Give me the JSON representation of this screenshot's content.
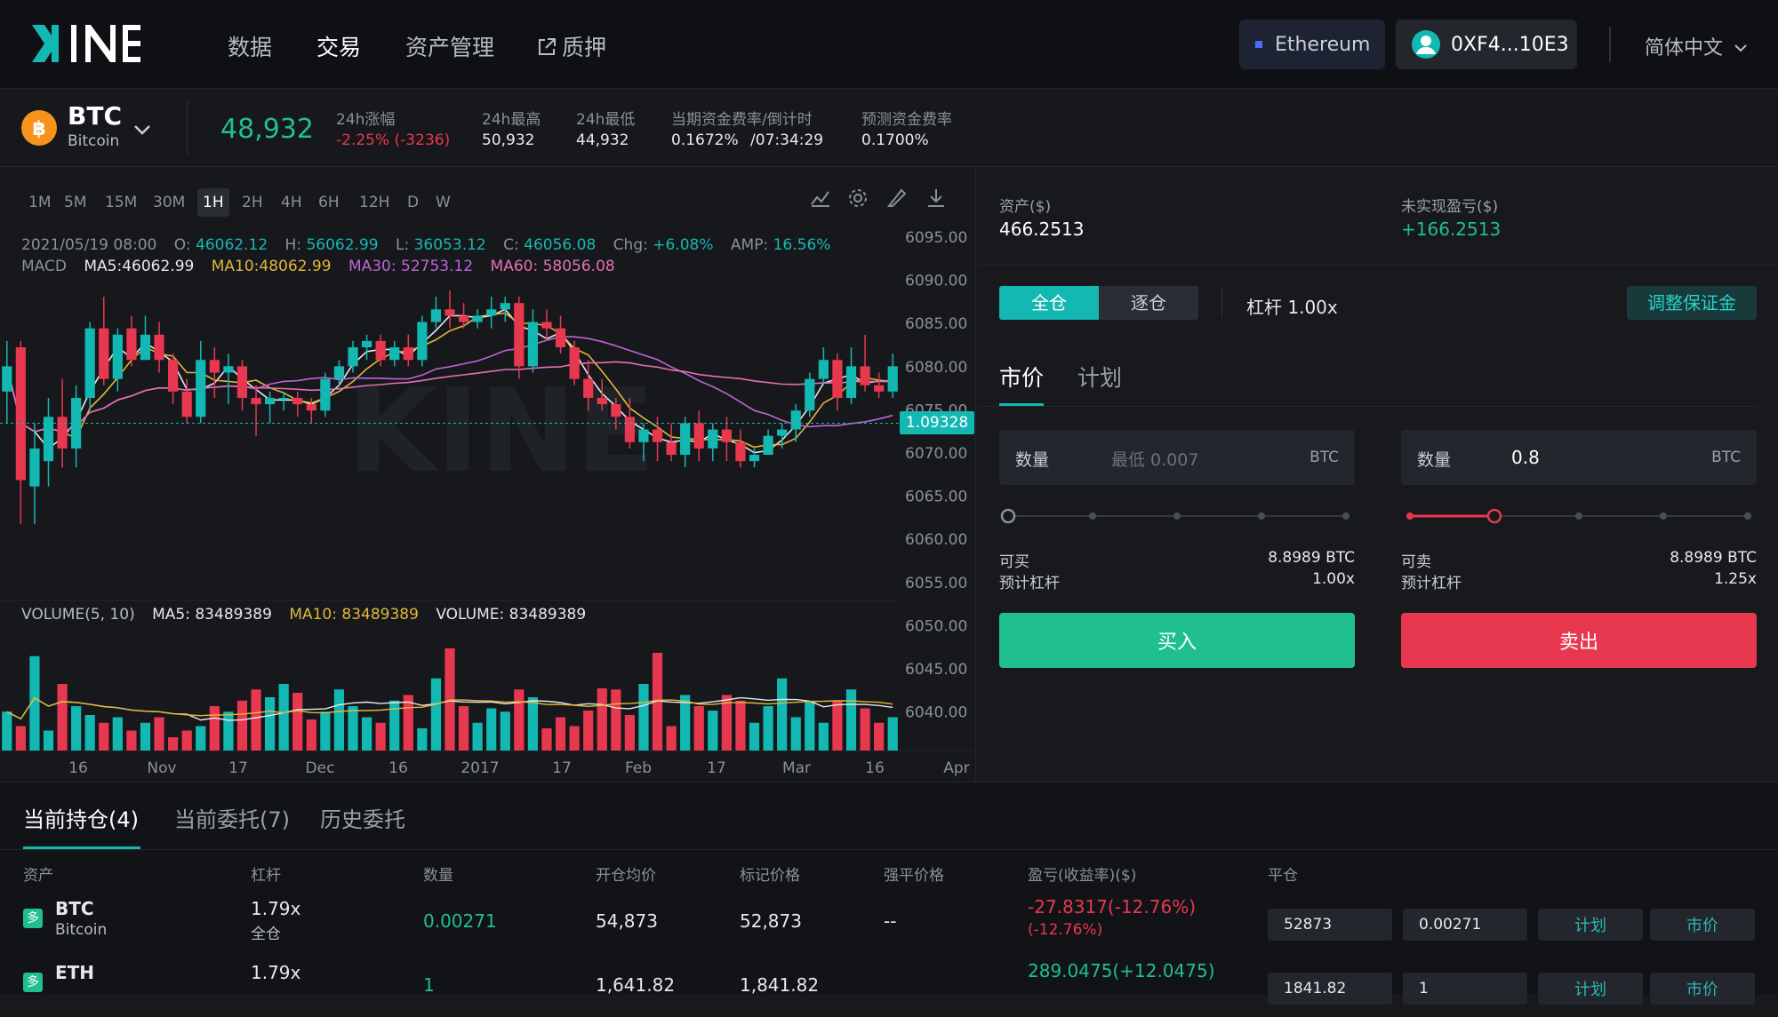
{
  "colors": {
    "accent": "#14b8b3",
    "up": "#1fbf8f",
    "down": "#e8384f",
    "bg": "#16181c"
  },
  "header": {
    "logo_text": "KINE",
    "nav": [
      {
        "label": "数据"
      },
      {
        "label": "交易"
      },
      {
        "label": "资产管理"
      },
      {
        "label": "质押",
        "icon": "external-link-icon"
      }
    ],
    "network": "Ethereum",
    "wallet": "0XF4...10E3",
    "language": "简体中文"
  },
  "ticker": {
    "symbol": "BTC",
    "name": "Bitcoin",
    "price": "48,932",
    "change_label": "24h涨幅",
    "change_value": "-2.25% (-3236)",
    "high_label": "24h最高",
    "high_value": "50,932",
    "low_label": "24h最低",
    "low_value": "44,932",
    "funding_label": "当期资金费率/倒计时",
    "funding_value": "0.1672%",
    "funding_countdown": "/07:34:29",
    "predicted_label": "预测资金费率",
    "predicted_value": "0.1700%"
  },
  "chart": {
    "intervals": [
      "1M",
      "5M",
      "15M",
      "30M",
      "1H",
      "2H",
      "4H",
      "6H",
      "12H",
      "D",
      "W"
    ],
    "active_interval": "1H",
    "tool_icons": [
      "indicator-icon",
      "settings-icon",
      "draw-icon",
      "download-icon"
    ],
    "ohlc": {
      "date": "2021/05/19 08:00",
      "o_label": "O:",
      "o": "46062.12",
      "h_label": "H:",
      "h": "56062.99",
      "l_label": "L:",
      "l": "36053.12",
      "c_label": "C:",
      "c": "46056.08",
      "chg_label": "Chg:",
      "chg": "+6.08%",
      "amp_label": "AMP:",
      "amp": "16.56%"
    },
    "macd": {
      "label": "MACD",
      "ma5": "MA5:46062.99",
      "ma10": "MA10:48062.99",
      "ma30": "MA30: 52753.12",
      "ma60": "MA60: 58056.08"
    },
    "volume": {
      "label": "VOLUME(5, 10)",
      "ma5": "MA5: 83489389",
      "ma10": "MA10: 83489389",
      "vol": "VOLUME: 83489389"
    },
    "current_price_tag": "1.09328",
    "current_price_level": 6068.0
  },
  "chart_data": {
    "type": "candlestick",
    "y_ticks": [
      "6095.00",
      "6090.00",
      "6085.00",
      "6080.00",
      "6075.00",
      "6070.00",
      "6065.00",
      "6060.00",
      "6055.00",
      "6050.00",
      "6045.00",
      "6040.00"
    ],
    "ylim": [
      6038,
      6097
    ],
    "x_ticks": [
      "16",
      "Nov",
      "17",
      "Dec",
      "16",
      "2017",
      "17",
      "Feb",
      "17",
      "Mar",
      "16",
      "Apr"
    ],
    "candles": [
      [
        6073,
        6081,
        6068,
        6077
      ],
      [
        6080,
        6081,
        6052,
        6059
      ],
      [
        6058,
        6068,
        6052,
        6064
      ],
      [
        6062,
        6072,
        6058,
        6069
      ],
      [
        6069,
        6075,
        6061,
        6064
      ],
      [
        6064,
        6074,
        6061,
        6072
      ],
      [
        6072,
        6084,
        6070,
        6083
      ],
      [
        6083,
        6088,
        6074,
        6075
      ],
      [
        6075,
        6083,
        6073,
        6082
      ],
      [
        6083,
        6085,
        6077,
        6078
      ],
      [
        6078,
        6085,
        6078,
        6082
      ],
      [
        6082,
        6084,
        6076,
        6078
      ],
      [
        6078,
        6079,
        6071,
        6073
      ],
      [
        6073,
        6075,
        6068,
        6069
      ],
      [
        6069,
        6081,
        6068,
        6078
      ],
      [
        6078,
        6080,
        6072,
        6076
      ],
      [
        6076,
        6079,
        6071,
        6077
      ],
      [
        6077,
        6078,
        6070,
        6072
      ],
      [
        6072,
        6074,
        6066,
        6071
      ],
      [
        6071,
        6073,
        6068,
        6072
      ],
      [
        6072,
        6073,
        6070,
        6072
      ],
      [
        6072,
        6073,
        6069,
        6071
      ],
      [
        6071,
        6072,
        6068,
        6070
      ],
      [
        6070,
        6076,
        6069,
        6075
      ],
      [
        6075,
        6078,
        6074,
        6077
      ],
      [
        6077,
        6081,
        6076,
        6080
      ],
      [
        6080,
        6082,
        6078,
        6081
      ],
      [
        6081,
        6082,
        6077,
        6078
      ],
      [
        6078,
        6081,
        6077,
        6080
      ],
      [
        6080,
        6082,
        6077,
        6078
      ],
      [
        6078,
        6085,
        6077,
        6084
      ],
      [
        6084,
        6088,
        6083,
        6086
      ],
      [
        6086,
        6089,
        6083,
        6085
      ],
      [
        6085,
        6087,
        6083,
        6084
      ],
      [
        6084,
        6086,
        6083,
        6085
      ],
      [
        6085,
        6088,
        6083,
        6086
      ],
      [
        6086,
        6088,
        6084,
        6087
      ],
      [
        6087,
        6088,
        6075,
        6077
      ],
      [
        6077,
        6086,
        6076,
        6084
      ],
      [
        6084,
        6086,
        6081,
        6083
      ],
      [
        6083,
        6085,
        6079,
        6080
      ],
      [
        6080,
        6081,
        6074,
        6075
      ],
      [
        6075,
        6078,
        6070,
        6072
      ],
      [
        6072,
        6075,
        6070,
        6071
      ],
      [
        6071,
        6072,
        6067,
        6069
      ],
      [
        6069,
        6072,
        6064,
        6065
      ],
      [
        6065,
        6068,
        6062,
        6067
      ],
      [
        6067,
        6069,
        6062,
        6065
      ],
      [
        6065,
        6068,
        6062,
        6063
      ],
      [
        6063,
        6069,
        6061,
        6068
      ],
      [
        6068,
        6070,
        6062,
        6064
      ],
      [
        6064,
        6068,
        6062,
        6067
      ],
      [
        6067,
        6069,
        6062,
        6065
      ],
      [
        6065,
        6067,
        6061,
        6062
      ],
      [
        6062,
        6064,
        6061,
        6063
      ],
      [
        6063,
        6067,
        6063,
        6066
      ],
      [
        6066,
        6068,
        6064,
        6067
      ],
      [
        6067,
        6071,
        6065,
        6070
      ],
      [
        6070,
        6076,
        6069,
        6075
      ],
      [
        6075,
        6080,
        6074,
        6078
      ],
      [
        6078,
        6079,
        6070,
        6072
      ],
      [
        6072,
        6080,
        6071,
        6077
      ],
      [
        6077,
        6082,
        6073,
        6074
      ],
      [
        6074,
        6076,
        6072,
        6073
      ],
      [
        6073,
        6079,
        6072,
        6077
      ]
    ],
    "volumes": [
      35,
      22,
      85,
      18,
      60,
      40,
      32,
      25,
      30,
      18,
      25,
      30,
      12,
      18,
      22,
      40,
      35,
      45,
      55,
      48,
      60,
      52,
      28,
      35,
      55,
      40,
      30,
      25,
      45,
      50,
      20,
      65,
      92,
      40,
      25,
      38,
      35,
      55,
      48,
      20,
      30,
      22,
      36,
      56,
      55,
      32,
      60,
      88,
      22,
      50,
      40,
      36,
      50,
      45,
      25,
      40,
      65,
      30,
      44,
      25,
      45,
      55,
      38,
      25,
      30
    ],
    "series": []
  },
  "order": {
    "asset_label": "资产($)",
    "asset_value": "466.2513",
    "pnl_label": "未实现盈亏($)",
    "pnl_value": "+166.2513",
    "margin_cross": "全仓",
    "margin_isolated": "逐仓",
    "leverage_label": "杠杆 1.00x",
    "adjust_margin": "调整保证金",
    "tab_market": "市价",
    "tab_plan": "计划",
    "buy_qty_label": "数量",
    "buy_qty_placeholder": "最低 0.007",
    "buy_unit": "BTC",
    "sell_qty_label": "数量",
    "sell_qty_value": "0.8",
    "sell_unit": "BTC",
    "buy_slider": 0.0,
    "sell_slider": 0.25,
    "can_buy_label": "可买",
    "can_buy_value": "8.8989 BTC",
    "est_lev_label": "预计杠杆",
    "buy_est_lev": "1.00x",
    "can_sell_label": "可卖",
    "can_sell_value": "8.8989 BTC",
    "sell_est_lev": "1.25x",
    "buy_button": "买入",
    "sell_button": "卖出"
  },
  "positions": {
    "tabs": [
      "当前持仓(4)",
      "当前委托(7)",
      "历史委托"
    ],
    "headers": [
      "资产",
      "杠杆",
      "数量",
      "开仓均价",
      "标记价格",
      "强平价格",
      "盈亏(收益率)($)",
      "平仓"
    ],
    "rows": [
      {
        "badge": "多",
        "symbol": "BTC",
        "name": "Bitcoin",
        "leverage": "1.79x",
        "mode": "全仓",
        "qty": "0.00271",
        "open": "54,873",
        "mark": "52,873",
        "liq": "--",
        "pnl": "-27.8317(-12.76%)",
        "pnl_sub": "(-12.76%)",
        "close_price": "52873",
        "close_qty": "0.00271",
        "btn_plan": "计划",
        "btn_market": "市价"
      },
      {
        "badge": "多",
        "symbol": "ETH",
        "leverage": "1.79x",
        "qty": "1",
        "open": "1,641.82",
        "mark": "1,841.82",
        "pnl": "289.0475(+12.0475)",
        "close_price": "1841.82",
        "close_qty": "1",
        "btn_plan": "计划",
        "btn_market": "市价"
      }
    ]
  }
}
